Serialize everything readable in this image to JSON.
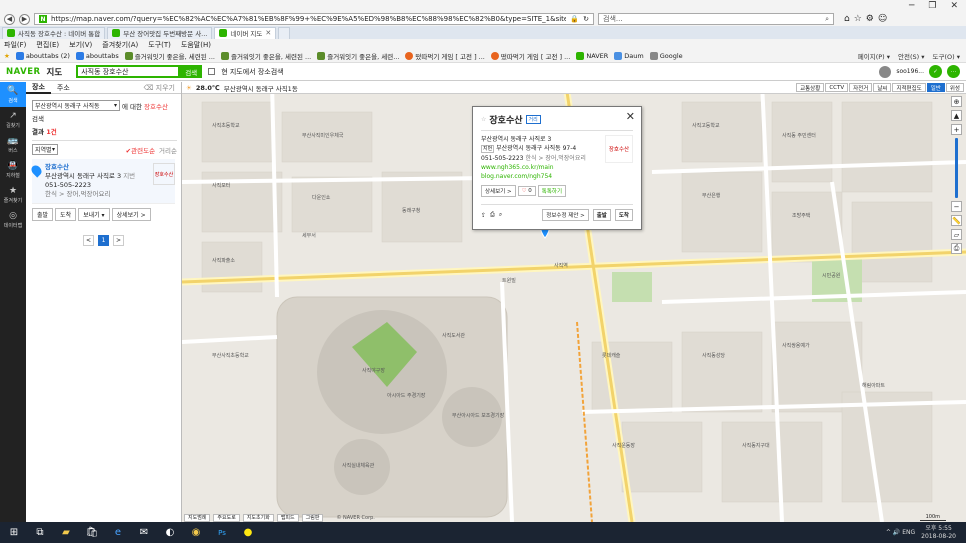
{
  "browser": {
    "url": "https://map.naver.com/?query=%EC%82%AC%EC%A7%81%EB%8F%99+%EC%9E%A5%ED%98%B8%EC%88%98%EC%82%B0&type=SITE_1&siteOrder=",
    "search_placeholder": "검색...",
    "window_controls": [
      "─",
      "❐",
      "✕"
    ],
    "tabs": [
      {
        "label": "사직동 장호수산 : 네이버 통합",
        "color": "#2db400"
      },
      {
        "label": "부산 장어맛집 두번째방문 사...",
        "color": "#2db400"
      },
      {
        "label": "네이버 지도",
        "color": "#2db400",
        "active": true
      }
    ],
    "menu": [
      "파일(F)",
      "편집(E)",
      "보기(V)",
      "즐겨찾기(A)",
      "도구(T)",
      "도움말(H)"
    ],
    "favorites": [
      {
        "label": "abouttabs (2)",
        "color": "#2c7be5"
      },
      {
        "label": "abouttabs",
        "color": "#2c7be5"
      },
      {
        "label": "즐거워잇기 좋은을, 세련된 ...",
        "color": "#5b8c2a"
      },
      {
        "label": "즐거워잇기 좋은을, 세련된 ...",
        "color": "#5b8c2a"
      },
      {
        "label": "즐거워잇기 좋은을, 세련...",
        "color": "#5b8c2a"
      },
      {
        "label": "떴따먹기 게임 [ 고전 ] ...",
        "color": "#e8641e"
      },
      {
        "label": "떴따먹기 게임 [ 고전 ] ...",
        "color": "#e8641e"
      },
      {
        "label": "NAVER",
        "color": "#2db400"
      },
      {
        "label": "Daum",
        "color": "#4a90e2"
      },
      {
        "label": "Google",
        "color": "#888888"
      }
    ],
    "command_items": [
      "페이지(P) ▾",
      "안전(S) ▾",
      "도구(O) ▾"
    ]
  },
  "naver": {
    "logo": "NAVER",
    "logo_suffix": "지도",
    "search_value": "사직동 장호수산",
    "search_button": "검색",
    "checkbox_label": "현 지도에서 장소검색",
    "user_label": "soo196..."
  },
  "left_nav": [
    {
      "label": "검색",
      "icon": "🔍",
      "active": true
    },
    {
      "label": "길찾기",
      "icon": "↗"
    },
    {
      "label": "버스",
      "icon": "🚌"
    },
    {
      "label": "지하철",
      "icon": "🚇"
    },
    {
      "label": "즐겨찾기",
      "icon": "★"
    },
    {
      "label": "데이터랩",
      "icon": "◎"
    }
  ],
  "panel": {
    "tabs": [
      "장소",
      "주소"
    ],
    "history_label": "지우기",
    "region_select": "부산광역시 동래구 사직동",
    "region_text": "에 대한 ",
    "region_query": "장호수산",
    "region_suffix": " 검색",
    "result_count_label": "결과 ",
    "result_count": "1건",
    "sort_label": "지역별",
    "filter_relevance": "관련도순",
    "filter_distance": "거리순",
    "result": {
      "name": "장호수산",
      "address": "부산광역시 동래구 사직로 3",
      "distance": "지번",
      "phone": "051-505-2223",
      "category": "한식 > 장어,먹장어요리",
      "buttons": [
        "출발",
        "도착",
        "보내기 ▾",
        "상세보기 >"
      ],
      "logo_text": "장호수산"
    },
    "pages": [
      "<",
      "1",
      ">"
    ]
  },
  "map": {
    "weather": "28.0℃",
    "weather_location": "부산광역시 동래구 사직1동",
    "map_types": [
      "교통상황",
      "CCTV",
      "자전거",
      "날씨",
      "지적편집도",
      "일반",
      "위성"
    ],
    "active_map_type": "일반",
    "popup": {
      "name": "장호수산",
      "badges": "거리",
      "road_address": "부산광역시 동래구 사직로 3",
      "jibun_label": "지번",
      "jibun_address": "부산광역시 동래구 사직동 97-4",
      "phone": "051-505-2223",
      "category": "한식 > 장어,먹장어요리",
      "link1": "www.ngh365.co.kr/main",
      "link2": "blog.naver.com/ngh754",
      "detail_button": "상세보기 >",
      "like_count": "0",
      "reserve_button": "톡톡하기",
      "info_edit": "정보수정 제안 >",
      "start": "출발",
      "arrive": "도착",
      "logo_text": "장호수산"
    },
    "labels": [
      "사직초등학교",
      "부산사직미인우체국",
      "사직모터",
      "다운인쇼",
      "동래구청",
      "사직파출소",
      "시민공원",
      "세무서",
      "사직고등학교",
      "사직동 주민센터",
      "부산은행",
      "사직역",
      "사직야구장",
      "조방주택",
      "사직실내체육관",
      "사직도서관",
      "부산아시아드 보조경기장",
      "아시아드 주경기장",
      "부산사직초등학교",
      "사직동성당",
      "롯데캐슬",
      "사직운동장",
      "트윈빌",
      "사직쌍용예가",
      "해림아파트",
      "사직동지구대"
    ],
    "scale": "100m",
    "copyright": "© NAVER Corp.",
    "bottom_tabs": [
      "지도범례",
      "주요도로",
      "지도초기화",
      "맵피드",
      "그림판"
    ]
  },
  "taskbar": {
    "time": "오후 5:55",
    "date": "2018-08-20",
    "tray": "^ 🔊 ENG"
  }
}
